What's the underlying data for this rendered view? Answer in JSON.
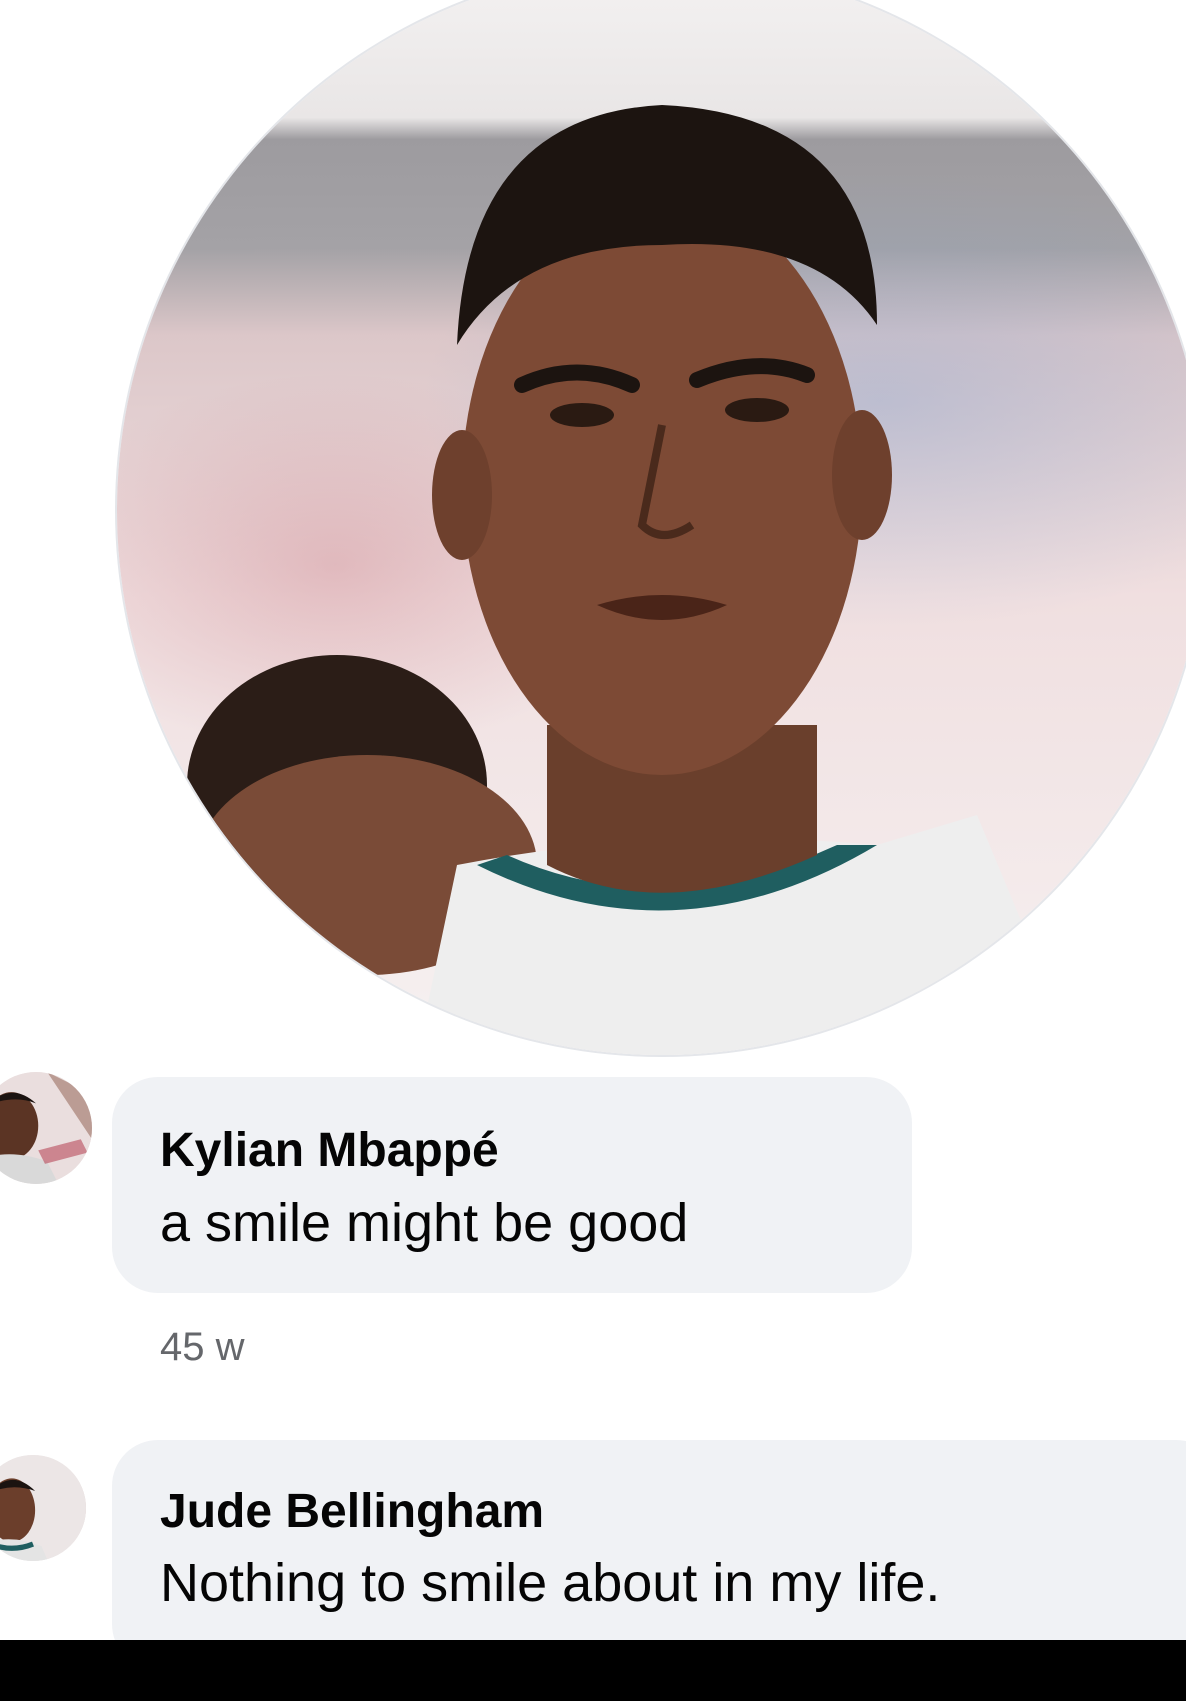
{
  "profile": {
    "photo_icon": "profile-photo-portrait"
  },
  "comments": [
    {
      "author": "Kylian Mbappé",
      "text": "a smile might be good",
      "time": "45 w",
      "avatar_icon": "user-avatar"
    },
    {
      "author": "Jude Bellingham",
      "text": "Nothing to smile about in my life.",
      "avatar_icon": "user-avatar"
    }
  ],
  "colors": {
    "bubble": "#f0f2f5",
    "text": "#050505",
    "meta": "#65676b"
  }
}
